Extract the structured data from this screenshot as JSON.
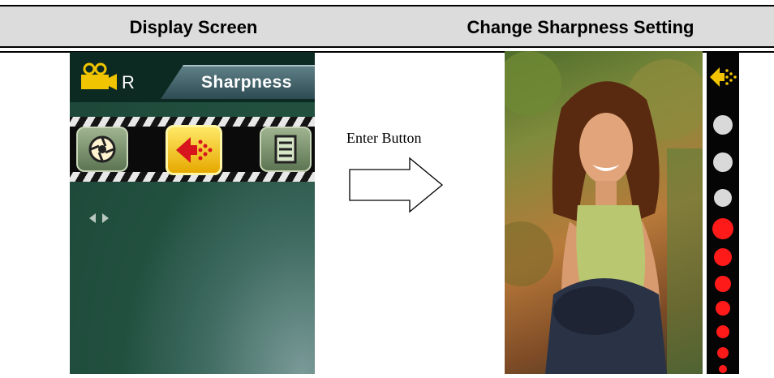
{
  "header": {
    "left_title": "Display Screen",
    "right_title": "Change Sharpness Setting"
  },
  "camera_screen": {
    "mode_letter": "R",
    "tab_label": "Sharpness",
    "menu_icons": [
      "effect-wheel-icon",
      "sharpness-icon",
      "list-icon"
    ],
    "selected_index": 1
  },
  "transition": {
    "label": "Enter Button"
  },
  "sharpness_screen": {
    "indicator_icon": "sharpness-icon",
    "level_dots": [
      "gray",
      "gray",
      "gray",
      "red",
      "red",
      "red",
      "red",
      "red",
      "red"
    ]
  },
  "colors": {
    "header_bg": "#dcdcdc",
    "dot_gray": "#d9d9d9",
    "dot_red": "#ff1a1a",
    "selected_yellow": "#ffd21a"
  }
}
